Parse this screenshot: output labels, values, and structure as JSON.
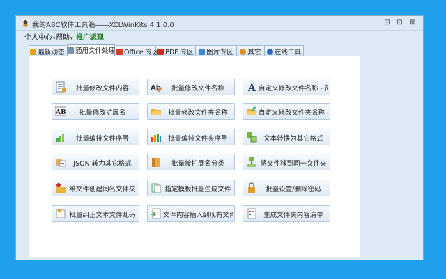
{
  "window": {
    "title": "我的ABC软件工具箱——XCLWinKits  4.1.0.0",
    "controls": [
      "⊟",
      "⊡",
      "⊠"
    ]
  },
  "menu": [
    {
      "label": "个人中心",
      "has_caret": true
    },
    {
      "label": "帮助",
      "has_caret": true
    },
    {
      "label": "推广返现",
      "has_caret": false
    }
  ],
  "tabs": [
    {
      "label": "最新动态",
      "icon": "star-icon",
      "color": "#e8a020",
      "active": false
    },
    {
      "label": "通用文件处理",
      "icon": "document-icon",
      "color": "#7a8fa8",
      "active": true
    },
    {
      "label": "Office 专区",
      "icon": "office-icon",
      "color": "#d04020",
      "active": false
    },
    {
      "label": "PDF 专区",
      "icon": "pdf-icon",
      "color": "#d02828",
      "active": false
    },
    {
      "label": "图片专区",
      "icon": "image-icon",
      "color": "#3a8ad8",
      "active": false
    },
    {
      "label": "其它",
      "icon": "other-icon",
      "color": "#e09028",
      "active": false
    },
    {
      "label": "在线工具",
      "icon": "globe-icon",
      "color": "#2a6ab8",
      "active": false
    }
  ],
  "buttons": [
    [
      {
        "label": "批量修改文件内容",
        "icon": "edit-document-icon"
      },
      {
        "label": "批量修改文件名称",
        "icon": "ab-rename-icon"
      },
      {
        "label": "自定义修改文件名称 - 简版",
        "icon": "letter-a-icon"
      }
    ],
    [
      {
        "label": "批量修改扩展名",
        "icon": "ab-extension-icon"
      },
      {
        "label": "批量修改文件夹名称",
        "icon": "folder-open-icon"
      },
      {
        "label": "自定义修改文件夹名称 - 简版",
        "icon": "folder-edit-icon"
      }
    ],
    [
      {
        "label": "批量编排文件序号",
        "icon": "bar-chart-green-icon"
      },
      {
        "label": "批量编排文件夹序号",
        "icon": "bar-chart-color-icon"
      },
      {
        "label": "文本转换为其它格式",
        "icon": "convert-squares-icon"
      }
    ],
    [
      {
        "label": "JSON 转为其它格式",
        "icon": "json-convert-icon"
      },
      {
        "label": "批量按扩展名分类",
        "icon": "book-classify-icon"
      },
      {
        "label": "将文件移到同一文件夹",
        "icon": "merge-files-icon"
      }
    ],
    [
      {
        "label": "给文件创建同名文件夹",
        "icon": "folder-create-icon"
      },
      {
        "label": "指定模板批量生成文件",
        "icon": "template-generate-icon"
      },
      {
        "label": "批量设置/删除密码",
        "icon": "lock-icon"
      }
    ],
    [
      {
        "label": "批量纠正文本文件乱码",
        "icon": "fix-encoding-icon"
      },
      {
        "label": "文件内容插入到现有文件",
        "icon": "insert-content-icon"
      },
      {
        "label": "生成文件夹内容清单",
        "icon": "list-icon"
      }
    ]
  ]
}
